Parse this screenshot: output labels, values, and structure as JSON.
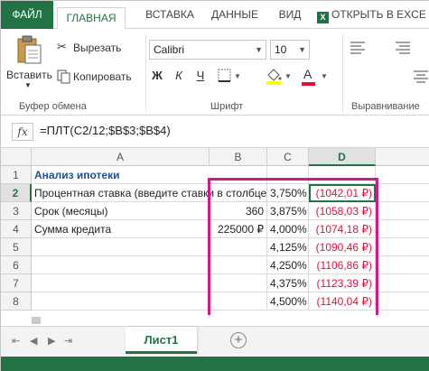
{
  "tabs": {
    "file": "ФАЙЛ",
    "home": "ГЛАВНАЯ",
    "insert": "ВСТАВКА",
    "data": "ДАННЫЕ",
    "view": "ВИД",
    "open_excel": "ОТКРЫТЬ В EXCE"
  },
  "ribbon": {
    "paste_label": "Вставить",
    "cut_label": "Вырезать",
    "copy_label": "Копировать",
    "clipboard_group": "Буфер обмена",
    "font_name": "Calibri",
    "font_size": "10",
    "font_group": "Шрифт",
    "alignment_group": "Выравнивание",
    "bold": "Ж",
    "italic": "К",
    "underline": "Ч",
    "font_color_letter": "A"
  },
  "formula_bar": {
    "fx": "fx",
    "formula": "=ПЛТ(C2/12;$B$3;$B$4)"
  },
  "grid": {
    "columns": [
      "A",
      "B",
      "C",
      "D"
    ],
    "rows": [
      "1",
      "2",
      "3",
      "4",
      "5",
      "6",
      "7",
      "8"
    ],
    "a1": "Анализ ипотеки",
    "a2": "Процентная ставка (введите ставки в столбце C)",
    "a3": "Срок (месяцы)",
    "a4": "Сумма кредита",
    "b3": "360",
    "b4": "225000 ₽",
    "c_values": [
      "3,750%",
      "3,875%",
      "4,000%",
      "4,125%",
      "4,250%",
      "4,375%",
      "4,500%"
    ],
    "d_values": [
      "(1042,01 ₽)",
      "(1058,03 ₽)",
      "(1074,18 ₽)",
      "(1090,46 ₽)",
      "(1106,86 ₽)",
      "(1123,39 ₽)",
      "(1140,04 ₽)"
    ]
  },
  "sheets": {
    "active": "Лист1",
    "add": "+"
  },
  "colors": {
    "brand": "#217346",
    "negative": "#e0103a",
    "highlight": "#d6168c",
    "title": "#1f4e99"
  }
}
